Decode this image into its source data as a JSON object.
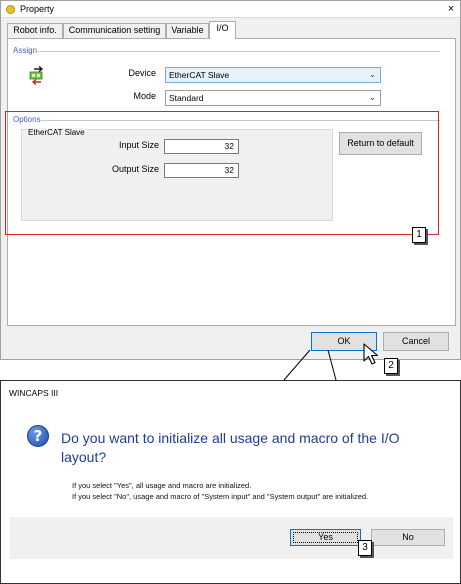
{
  "property_window": {
    "title": "Property",
    "close": "×",
    "tabs": [
      "Robot info.",
      "Communication setting",
      "Variable",
      "I/O"
    ],
    "assign": {
      "section_label": "Assign",
      "device_label": "Device",
      "device_value": "EtherCAT Slave",
      "mode_label": "Mode",
      "mode_value": "Standard",
      "arrow": "⌄"
    },
    "options": {
      "section_label": "Options",
      "group_label": "EtherCAT Slave",
      "input_size_label": "Input Size",
      "input_size_value": "32",
      "output_size_label": "Output Size",
      "output_size_value": "32",
      "return_default_label": "Return to default"
    },
    "ok_label": "OK",
    "cancel_label": "Cancel"
  },
  "callouts": [
    "1",
    "2",
    "3"
  ],
  "dialog": {
    "title": "WINCAPS III",
    "icon_glyph": "?",
    "heading": "Do you want to initialize all usage and macro of the I/O layout?",
    "note_yes": "If you select \"Yes\", all usage and macro are initialized.",
    "note_no": "If you select \"No\", usage and macro of \"System input\" and \"System output\" are initialized.",
    "yes_label": "Yes",
    "no_label": "No"
  },
  "colors": {
    "highlight_red": "#e02020",
    "heading_blue": "#1e3c9a",
    "section_blue": "#3c62c8"
  },
  "icons": [
    "property-app-icon",
    "close-icon",
    "io-assign-icon",
    "chevron-down-icon",
    "mouse-cursor-icon",
    "question-icon"
  ]
}
